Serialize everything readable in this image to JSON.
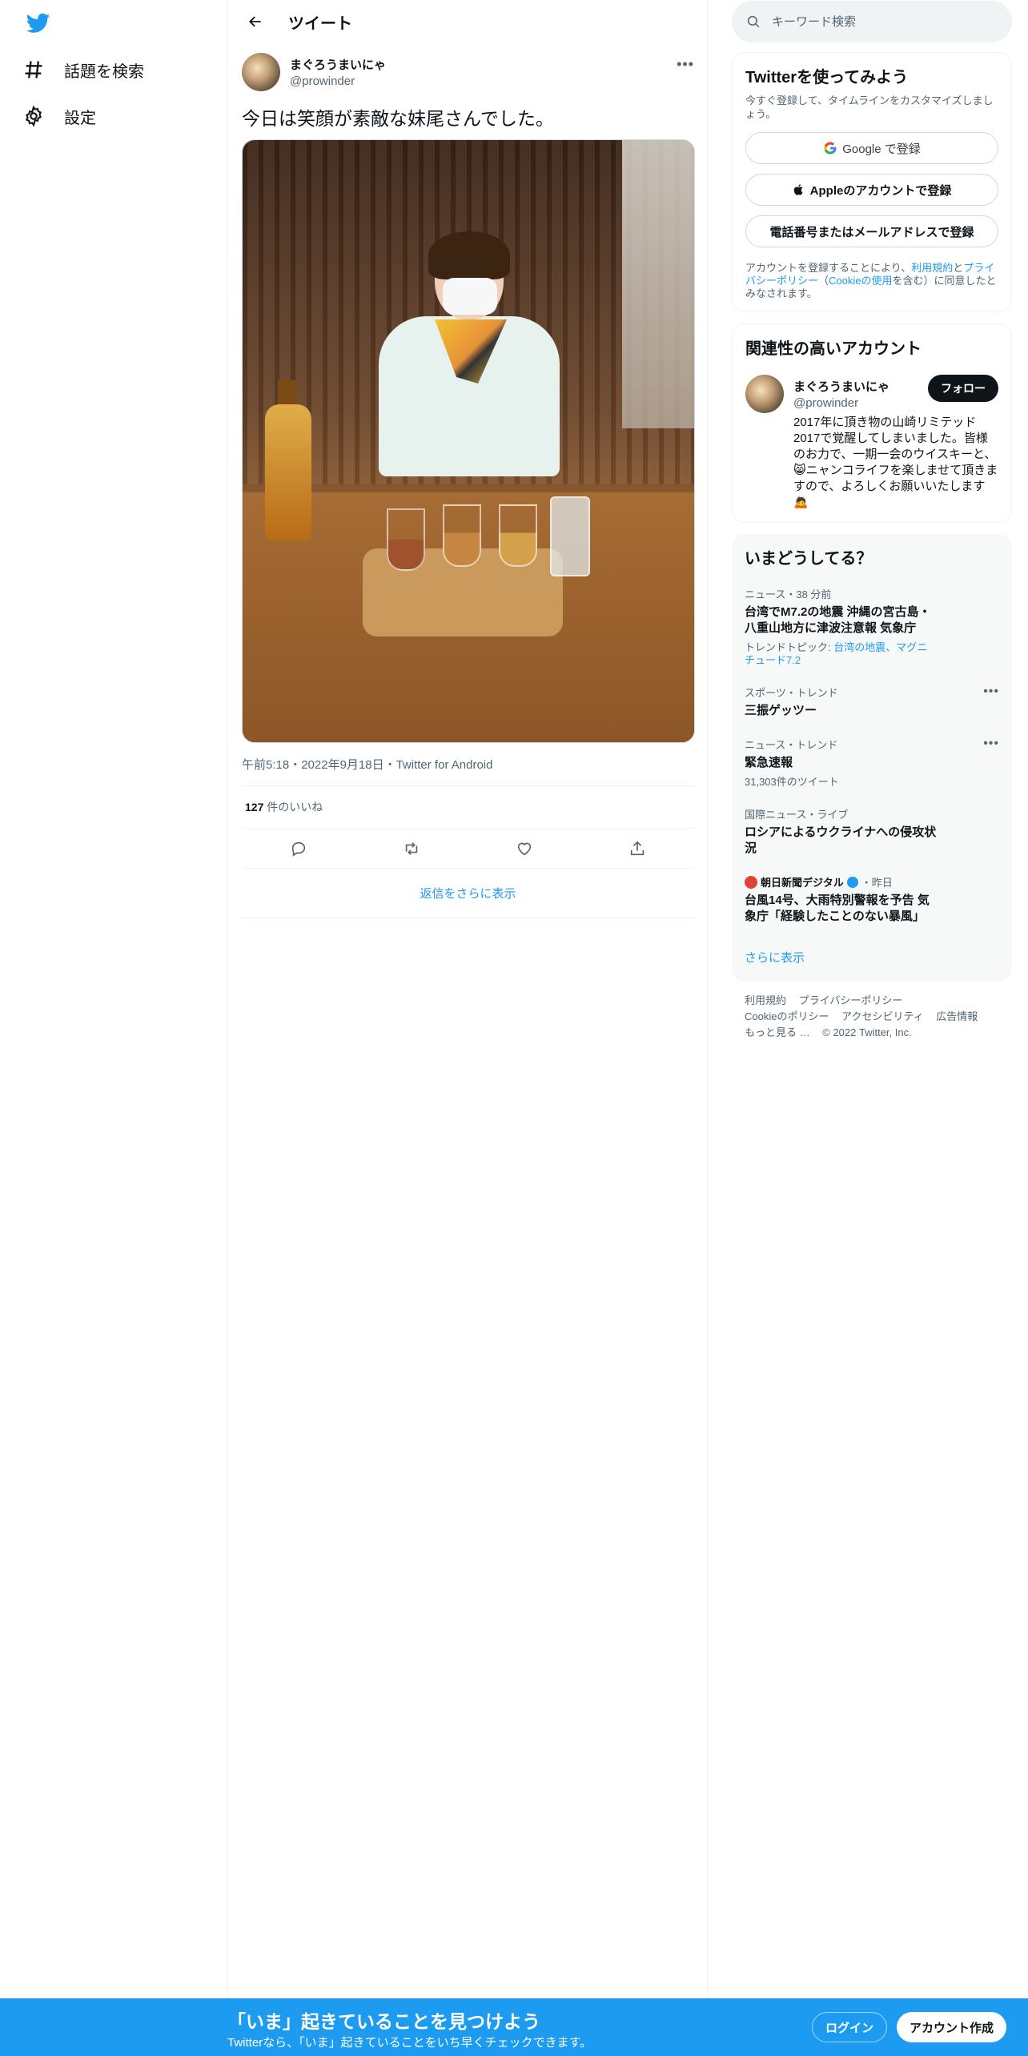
{
  "nav": {
    "items": [
      {
        "label": "話題を検索",
        "icon": "hashtag-icon"
      },
      {
        "label": "設定",
        "icon": "gear-icon"
      }
    ]
  },
  "header": {
    "title": "ツイート"
  },
  "tweet": {
    "author_name": "まぐろうまいにゃ",
    "author_handle": "@prowinder",
    "text": "今日は笑顔が素敵な妹尾さんでした。",
    "meta": "午前5:18・2022年9月18日・Twitter for Android",
    "likes_count": "127",
    "likes_label": "件のいいね",
    "show_replies": "返信をさらに表示"
  },
  "search": {
    "placeholder": "キーワード検索"
  },
  "signup_card": {
    "title": "Twitterを使ってみよう",
    "subtitle": "今すぐ登録して、タイムラインをカスタマイズしましょう。",
    "google_button": "Google で登録",
    "apple_button": "Appleのアカウントで登録",
    "phone_button": "電話番号またはメールアドレスで登録",
    "legal_prefix": "アカウントを登録することにより、",
    "legal_terms": "利用規約",
    "legal_and": "と",
    "legal_privacy": "プライバシーポリシー",
    "legal_paren_open": "（",
    "legal_cookie": "Cookieの使用",
    "legal_suffix": "を含む）に同意したとみなされます。"
  },
  "related": {
    "title": "関連性の高いアカウント",
    "name": "まぐろうまいにゃ",
    "handle": "@prowinder",
    "follow_label": "フォロー",
    "bio": "2017年に頂き物の山崎リミテッド2017で覚醒してしまいました。皆様のお力で、一期一会のウイスキーと、😸ニャンコライフを楽しませて頂きますので、よろしくお願いいたします🙇"
  },
  "trends": {
    "title": "いまどうしてる？",
    "items": [
      {
        "meta": "ニュース・38 分前",
        "title": "台湾でM7.2の地震 沖縄の宮古島・八重山地方に津波注意報 気象庁",
        "sub_prefix": "トレンドトピック: ",
        "sub_links": "台湾の地震、マグニチュード7.2"
      },
      {
        "meta": "スポーツ・トレンド",
        "title": "三振ゲッツー"
      },
      {
        "meta": "ニュース・トレンド",
        "title": "緊急速報",
        "sub": "31,303件のツイート"
      },
      {
        "meta": "国際ニュース・ライブ",
        "title": "ロシアによるウクライナへの侵攻状況"
      },
      {
        "source": "朝日新聞デジタル",
        "time": "・昨日",
        "title": "台風14号、大雨特別警報を予告 気象庁「経験したことのない暴風」"
      }
    ],
    "show_more": "さらに表示"
  },
  "footer": {
    "terms": "利用規約",
    "privacy": "プライバシーポリシー",
    "cookie": "Cookieのポリシー",
    "accessibility": "アクセシビリティ",
    "ads": "広告情報",
    "more": "もっと見る …",
    "copyright": "© 2022 Twitter, Inc."
  },
  "bottom_bar": {
    "title": "「いま」起きていることを見つけよう",
    "subtitle": "Twitterなら、「いま」起きていることをいち早くチェックできます。",
    "login": "ログイン",
    "signup": "アカウント作成"
  },
  "colors": {
    "accent": "#1d9bf0",
    "text": "#0f1419",
    "secondary": "#536471"
  }
}
